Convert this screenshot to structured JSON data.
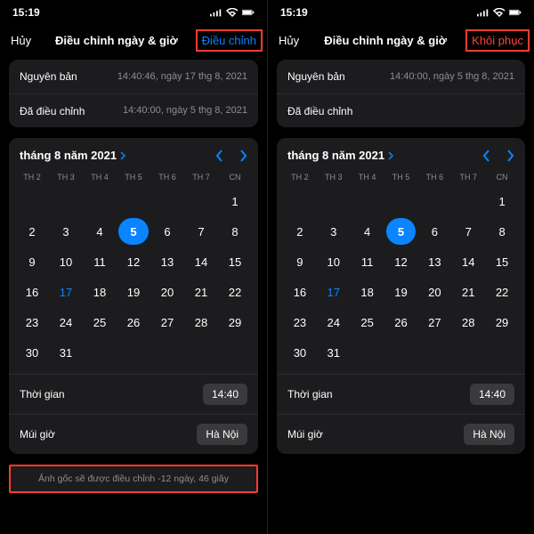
{
  "status": {
    "time": "15:19"
  },
  "left": {
    "cancel": "Hủy",
    "title": "Điều chỉnh ngày & giờ",
    "action": "Điều chỉnh",
    "orig_label": "Nguyên bản",
    "orig_value": "14:40:46, ngày 17 thg 8, 2021",
    "adj_label": "Đã điều chỉnh",
    "adj_value": "14:40:00, ngày 5 thg 8, 2021",
    "month": "tháng 8 năm 2021",
    "weekdays": [
      "TH 2",
      "TH 3",
      "TH 4",
      "TH 5",
      "TH 6",
      "TH 7",
      "CN"
    ],
    "selected_day": "5",
    "today_day": "17",
    "time_label": "Thời gian",
    "time_value": "14:40",
    "tz_label": "Múi giờ",
    "tz_value": "Hà Nội",
    "info": "Ảnh gốc sẽ được điều chỉnh -12 ngày, 46 giây"
  },
  "right": {
    "cancel": "Hủy",
    "title": "Điều chỉnh ngày & giờ",
    "action": "Khôi phục",
    "orig_label": "Nguyên bản",
    "orig_value": "14:40:00, ngày 5 thg 8, 2021",
    "adj_label": "Đã điều chỉnh",
    "adj_value": "",
    "month": "tháng 8 năm 2021",
    "weekdays": [
      "TH 2",
      "TH 3",
      "TH 4",
      "TH 5",
      "TH 6",
      "TH 7",
      "CN"
    ],
    "selected_day": "5",
    "today_day": "17",
    "time_label": "Thời gian",
    "time_value": "14:40",
    "tz_label": "Múi giờ",
    "tz_value": "Hà Nội"
  },
  "days_grid": [
    "",
    "",
    "",
    "",
    "",
    "",
    "1",
    "2",
    "3",
    "4",
    "5",
    "6",
    "7",
    "8",
    "9",
    "10",
    "11",
    "12",
    "13",
    "14",
    "15",
    "16",
    "17",
    "18",
    "19",
    "20",
    "21",
    "22",
    "23",
    "24",
    "25",
    "26",
    "27",
    "28",
    "29",
    "30",
    "31",
    "",
    "",
    "",
    "",
    ""
  ]
}
